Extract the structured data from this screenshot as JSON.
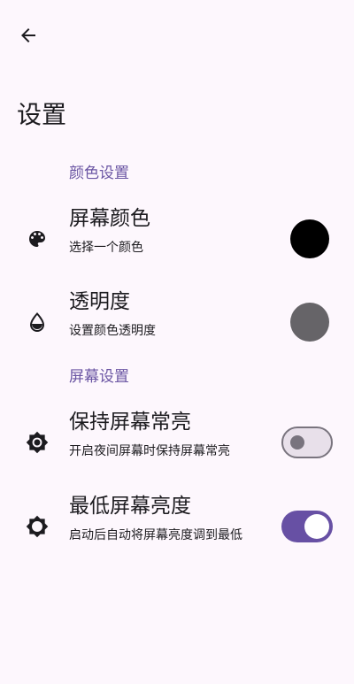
{
  "header": {
    "back_icon": "arrow-back-icon",
    "title": "设置"
  },
  "sections": [
    {
      "label": "颜色设置",
      "items": [
        {
          "title": "屏幕颜色",
          "summary": "选择一个颜色",
          "icon": "palette-icon",
          "swatch_color": "#000000"
        },
        {
          "title": "透明度",
          "summary": "设置颜色透明度",
          "icon": "opacity-drop-icon",
          "swatch_color": "#666468"
        }
      ]
    },
    {
      "label": "屏幕设置",
      "items": [
        {
          "title": "保持屏幕常亮",
          "summary": "开启夜间屏幕时保持屏幕常亮",
          "icon": "brightness-high-icon",
          "switch_on": false
        },
        {
          "title": "最低屏幕亮度",
          "summary": "启动后自动将屏幕亮度调到最低",
          "icon": "brightness-low-icon",
          "switch_on": true
        }
      ]
    }
  ],
  "colors": {
    "accent": "#6750a4",
    "section_header": "#6a55a3",
    "background": "#fdf7fd"
  }
}
